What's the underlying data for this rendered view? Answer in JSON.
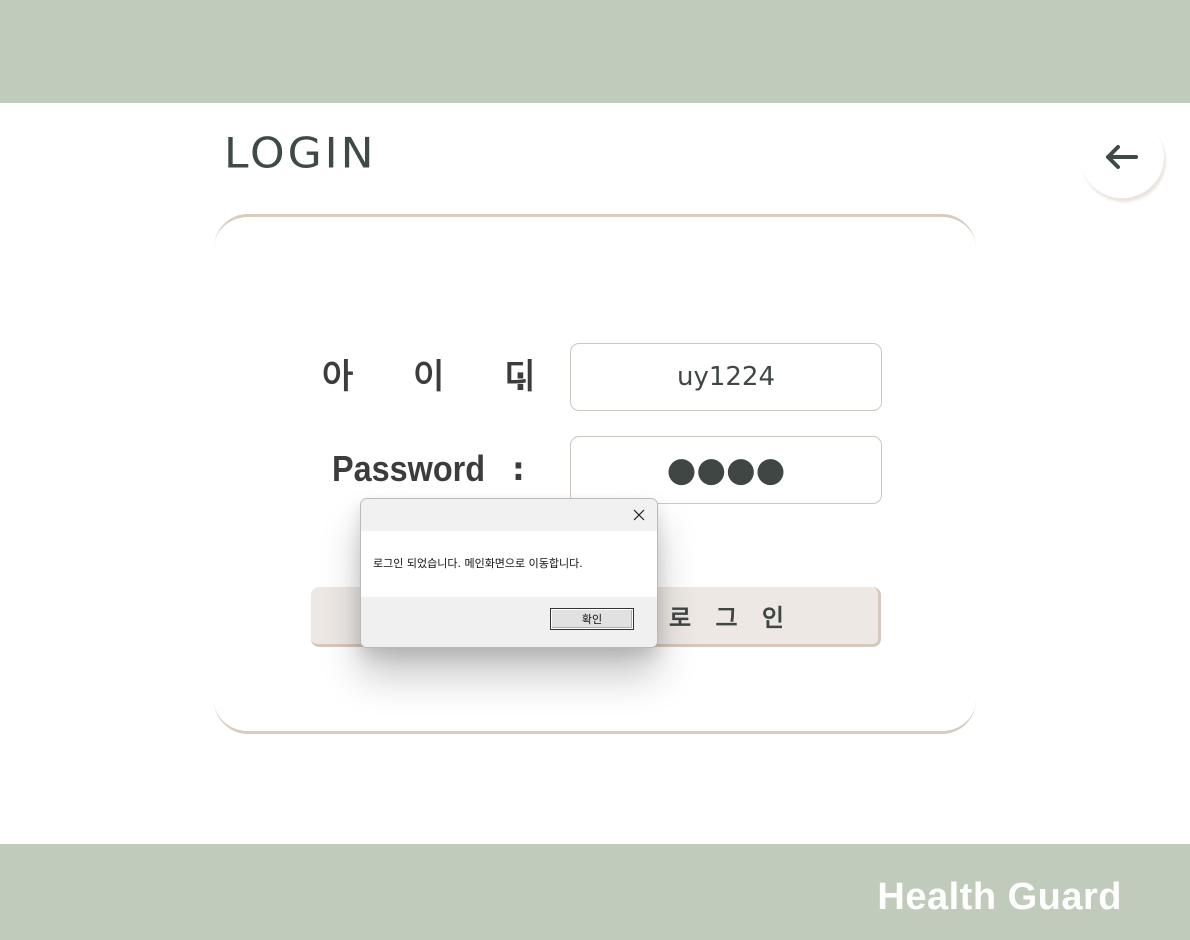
{
  "header": {
    "title": "LOGIN",
    "back_icon": "arrow-left-icon"
  },
  "form": {
    "id_label": "아 이 디",
    "id_colon": ":",
    "id_value": "uy1224",
    "password_label": "Password",
    "password_colon": ":",
    "password_value": "●●●●",
    "submit_label": "로 그 인"
  },
  "dialog": {
    "close_icon": "close-icon",
    "message": "로그인 되었습니다. 메인화면으로 이동합니다.",
    "ok_label": "확인"
  },
  "footer": {
    "brand": "Health Guard"
  },
  "colors": {
    "band": "#c1cbbc",
    "card_border": "#d8cbc0",
    "button_bg": "#ede8e4",
    "text": "#3f4644"
  }
}
